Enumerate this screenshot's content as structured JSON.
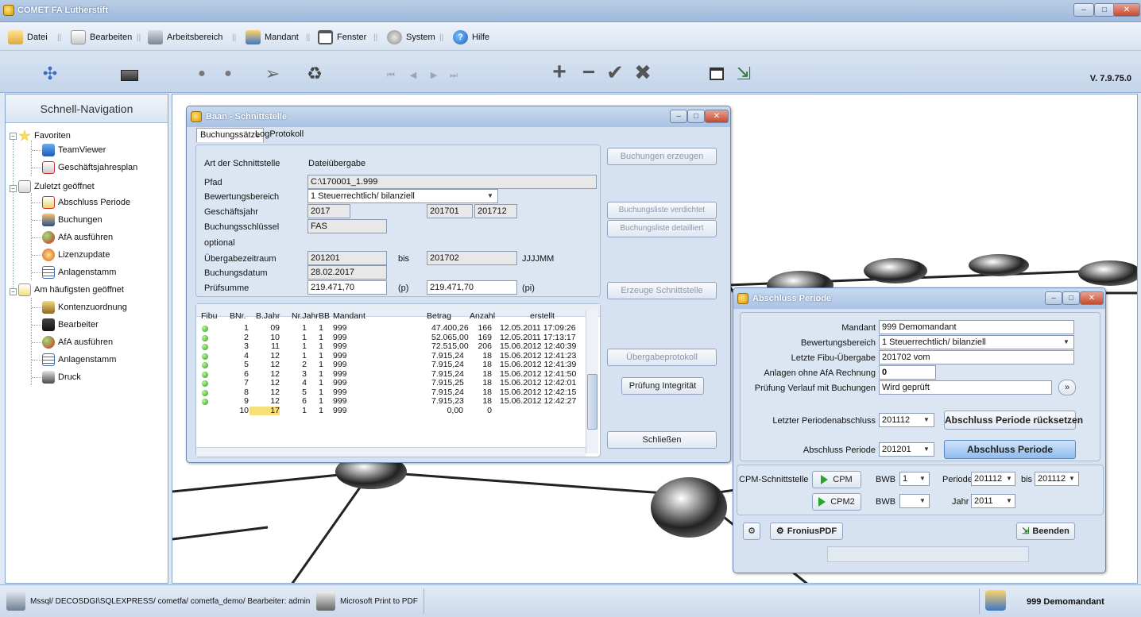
{
  "app": {
    "title": "COMET FA Lutherstift",
    "version": "V. 7.9.75.0"
  },
  "menu": [
    {
      "label": "Datei",
      "icon": "folder-open-icon"
    },
    {
      "label": "Bearbeiten",
      "icon": "edit-icon"
    },
    {
      "label": "Arbeitsbereich",
      "icon": "workspace-icon"
    },
    {
      "label": "Mandant",
      "icon": "users-icon"
    },
    {
      "label": "Fenster",
      "icon": "window-icon"
    },
    {
      "label": "System",
      "icon": "gears-icon"
    },
    {
      "label": "Hilfe",
      "icon": "help-icon"
    }
  ],
  "sidebar": {
    "title": "Schnell-Navigation",
    "groups": [
      {
        "label": "Favoriten",
        "items": [
          "TeamViewer",
          "Geschäftsjahresplan"
        ]
      },
      {
        "label": "Zuletzt geöffnet",
        "items": [
          "Abschluss Periode",
          "Buchungen",
          "AfA ausführen",
          "Lizenzupdate",
          "Anlagenstamm"
        ]
      },
      {
        "label": "Am häufigsten geöffnet",
        "items": [
          "Kontenzuordnung",
          "Bearbeiter",
          "AfA ausführen",
          "Anlagenstamm",
          "Druck"
        ]
      }
    ]
  },
  "baan": {
    "title": "Baan - Schnittstelle",
    "tabs": [
      "Buchungssätze",
      "LogProtokoll"
    ],
    "fields": {
      "art_label": "Art der Schnittstelle",
      "art_value": "Dateiübergabe",
      "pfad_label": "Pfad",
      "pfad_value": "C:\\170001_1.999",
      "bewertung_label": "Bewertungsbereich",
      "bewertung_value": "1 Steuerrechtlich/ bilanziell",
      "gj_label": "Geschäftsjahr",
      "gj_value": "2017",
      "gj_from": "201701",
      "gj_to": "201712",
      "bs_label": "Buchungsschlüssel",
      "bs_value": "FAS",
      "optional_label": "optional",
      "uz_label": "Übergabezeitraum",
      "uz_from": "201201",
      "uz_bis": "bis",
      "uz_to": "201702",
      "uz_format": "JJJJMM",
      "bd_label": "Buchungsdatum",
      "bd_value": "28.02.2017",
      "ps_label": "Prüfsumme",
      "ps_value": "219.471,70",
      "ps_unit": "(p)",
      "psi_value": "219.471,70",
      "psi_unit": "(pi)"
    },
    "buttons": {
      "erzeugen": "Buchungen erzeugen",
      "verdichtet": "Buchungsliste verdichtet",
      "detailliert": "Buchungsliste detailliert",
      "schnittstelle": "Erzeuge Schnittstelle",
      "protokoll": "Übergabeprotokoll",
      "integritaet": "Prüfung Integrität",
      "schliessen": "Schließen"
    },
    "grid": {
      "columns": [
        "Fibu",
        "BNr.",
        "B.Jahr",
        "Nr.Jahr",
        "BB",
        "Mandant",
        "Betrag",
        "Anzahl",
        "erstellt"
      ],
      "rows": [
        {
          "bnr": "1",
          "bjahr": "09",
          "nrjahr": "1",
          "bb": "1",
          "mandant": "999",
          "betrag": "47.400,26",
          "anzahl": "166",
          "erstellt": "12.05.2011 17:09:26",
          "ok": true
        },
        {
          "bnr": "2",
          "bjahr": "10",
          "nrjahr": "1",
          "bb": "1",
          "mandant": "999",
          "betrag": "52.065,00",
          "anzahl": "169",
          "erstellt": "12.05.2011 17:13:17",
          "ok": true
        },
        {
          "bnr": "3",
          "bjahr": "11",
          "nrjahr": "1",
          "bb": "1",
          "mandant": "999",
          "betrag": "72.515,00",
          "anzahl": "206",
          "erstellt": "15.06.2012 12:40:39",
          "ok": true
        },
        {
          "bnr": "4",
          "bjahr": "12",
          "nrjahr": "1",
          "bb": "1",
          "mandant": "999",
          "betrag": "7.915,24",
          "anzahl": "18",
          "erstellt": "15.06.2012 12:41:23",
          "ok": true
        },
        {
          "bnr": "5",
          "bjahr": "12",
          "nrjahr": "2",
          "bb": "1",
          "mandant": "999",
          "betrag": "7.915,24",
          "anzahl": "18",
          "erstellt": "15.06.2012 12:41:39",
          "ok": true
        },
        {
          "bnr": "6",
          "bjahr": "12",
          "nrjahr": "3",
          "bb": "1",
          "mandant": "999",
          "betrag": "7.915,24",
          "anzahl": "18",
          "erstellt": "15.06.2012 12:41:50",
          "ok": true
        },
        {
          "bnr": "7",
          "bjahr": "12",
          "nrjahr": "4",
          "bb": "1",
          "mandant": "999",
          "betrag": "7.915,25",
          "anzahl": "18",
          "erstellt": "15.06.2012 12:42:01",
          "ok": true
        },
        {
          "bnr": "8",
          "bjahr": "12",
          "nrjahr": "5",
          "bb": "1",
          "mandant": "999",
          "betrag": "7.915,24",
          "anzahl": "18",
          "erstellt": "15.06.2012 12:42:15",
          "ok": true
        },
        {
          "bnr": "9",
          "bjahr": "12",
          "nrjahr": "6",
          "bb": "1",
          "mandant": "999",
          "betrag": "7.915,23",
          "anzahl": "18",
          "erstellt": "15.06.2012 12:42:27",
          "ok": true
        },
        {
          "bnr": "10",
          "bjahr": "17",
          "nrjahr": "1",
          "bb": "1",
          "mandant": "999",
          "betrag": "0,00",
          "anzahl": "0",
          "erstellt": "",
          "ok": false
        }
      ]
    }
  },
  "abschluss": {
    "title": "Abschluss Periode",
    "mandant_label": "Mandant",
    "mandant_value": "999 Demomandant",
    "bewertung_label": "Bewertungsbereich",
    "bewertung_value": "1 Steuerrechtlich/ bilanziell",
    "letzte_label": "Letzte Fibu-Übergabe",
    "letzte_value": "201702 vom",
    "ohne_afa_label": "Anlagen ohne AfA Rechnung",
    "ohne_afa_value": "0",
    "pruefung_label": "Prüfung Verlauf mit Buchungen",
    "pruefung_value": "Wird geprüft",
    "letzter_label": "Letzter Periodenabschluss",
    "letzter_value": "201112",
    "ruecksetzen_label": "Abschluss Periode rücksetzen",
    "periode_label": "Abschluss Periode",
    "periode_value": "201201",
    "periode_button": "Abschluss Periode",
    "cpm_label": "CPM-Schnittstelle",
    "cpm_button": "CPM",
    "cpm2_button": "CPM2",
    "bwb_label": "BWB",
    "bwb_value": "1",
    "bwb2_value": "",
    "periode2_label": "Periode",
    "periode2_from": "201112",
    "bis_label": "bis",
    "periode2_to": "201112",
    "jahr_label": "Jahr",
    "jahr_value": "2011",
    "fronius_button": "FroniusPDF",
    "beenden_button": "Beenden"
  },
  "status": {
    "connection": "Mssql/ DECOSDGI\\SQLEXPRESS/ cometfa/ cometfa_demo/ Bearbeiter: admin",
    "printer": "Microsoft Print to PDF",
    "mandant": "999  Demomandant"
  }
}
